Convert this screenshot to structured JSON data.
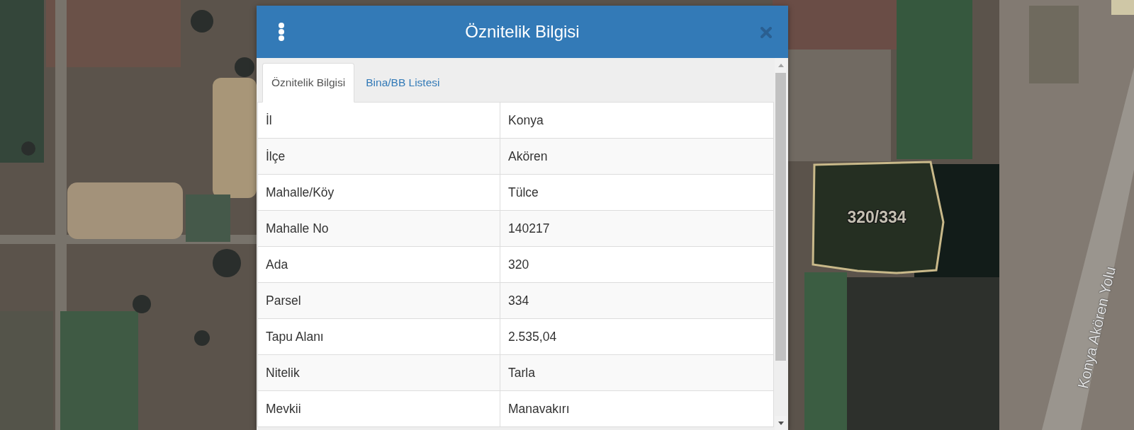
{
  "map": {
    "parcel_label": "320/334",
    "road_label": "Konya Akören Yolu"
  },
  "dialog": {
    "title": "Öznitelik Bilgisi",
    "tabs": [
      {
        "label": "Öznitelik Bilgisi",
        "selected": true
      },
      {
        "label": "Bina/BB Listesi",
        "selected": false
      }
    ],
    "rows": [
      {
        "field": "İl",
        "value": "Konya"
      },
      {
        "field": "İlçe",
        "value": "Akören"
      },
      {
        "field": "Mahalle/Köy",
        "value": "Tülce"
      },
      {
        "field": "Mahalle No",
        "value": "140217"
      },
      {
        "field": "Ada",
        "value": "320"
      },
      {
        "field": "Parsel",
        "value": "334"
      },
      {
        "field": "Tapu Alanı",
        "value": "2.535,04"
      },
      {
        "field": "Nitelik",
        "value": "Tarla"
      },
      {
        "field": "Mevkii",
        "value": "Manavakırı"
      }
    ]
  }
}
